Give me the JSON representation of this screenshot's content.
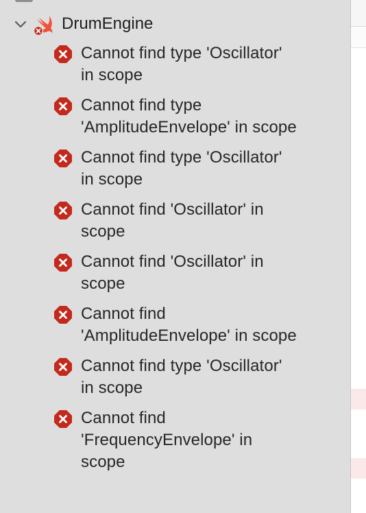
{
  "navigator": {
    "group": {
      "title": "DrumEngine",
      "expanded": true
    },
    "issues": [
      {
        "severity": "error",
        "line1": "Cannot find type 'Oscillator'",
        "line2": "in scope",
        "line3": ""
      },
      {
        "severity": "error",
        "line1": "Cannot find type",
        "line2": "'AmplitudeEnvelope' in scope",
        "line3": ""
      },
      {
        "severity": "error",
        "line1": "Cannot find type 'Oscillator'",
        "line2": "in scope",
        "line3": ""
      },
      {
        "severity": "error",
        "line1": "Cannot find 'Oscillator' in",
        "line2": "scope",
        "line3": ""
      },
      {
        "severity": "error",
        "line1": "Cannot find 'Oscillator' in",
        "line2": "scope",
        "line3": ""
      },
      {
        "severity": "error",
        "line1": "Cannot find",
        "line2": "'AmplitudeEnvelope' in scope",
        "line3": ""
      },
      {
        "severity": "error",
        "line1": "Cannot find type 'Oscillator'",
        "line2": "in scope",
        "line3": ""
      },
      {
        "severity": "error",
        "line1": "Cannot find",
        "line2": "'FrequencyEnvelope' in",
        "line3": "scope"
      }
    ]
  },
  "colors": {
    "sidebar_bg": "#dedede",
    "error_red": "#c3291c",
    "swift_orange": "#f05138",
    "editor_error_highlight": "#fbe9e9"
  },
  "icons": {
    "chevron": "chevron-down-icon",
    "file": "swift-file-icon",
    "error": "error-icon"
  }
}
